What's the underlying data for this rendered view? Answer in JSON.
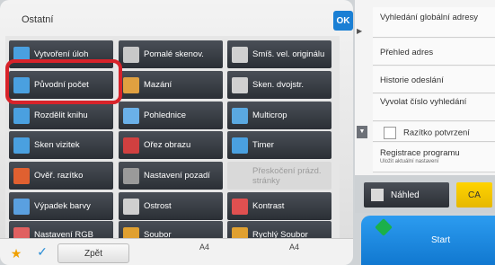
{
  "panel": {
    "title": "Ostatní",
    "ok_label": "OK"
  },
  "functions": [
    {
      "label": "Vytvoření úloh",
      "icon": "job-build-icon",
      "color": "#4aa0e0",
      "disabled": false
    },
    {
      "label": "Pomalé skenov.",
      "icon": "slow-scan-icon",
      "color": "#c8c8c8",
      "disabled": false
    },
    {
      "label": "Smíš. vel. originálu",
      "icon": "mixed-size-icon",
      "color": "#d0d0d0",
      "disabled": false
    },
    {
      "label": "Původní počet",
      "icon": "original-count-icon",
      "color": "#4aa0e0",
      "disabled": false
    },
    {
      "label": "Mazání",
      "icon": "erase-icon",
      "color": "#e0a040",
      "disabled": false
    },
    {
      "label": "Sken. dvojstr.",
      "icon": "dual-page-scan-icon",
      "color": "#d0d0d0",
      "disabled": false
    },
    {
      "label": "Rozdělit knihu",
      "icon": "book-divide-icon",
      "color": "#4aa0e0",
      "disabled": false
    },
    {
      "label": "Pohlednice",
      "icon": "postcard-icon",
      "color": "#6ab0e8",
      "disabled": false
    },
    {
      "label": "Multicrop",
      "icon": "multicrop-icon",
      "color": "#5aa8e0",
      "disabled": false
    },
    {
      "label": "Sken vizitek",
      "icon": "business-card-icon",
      "color": "#4aa0e0",
      "disabled": false
    },
    {
      "label": "Ořez obrazu",
      "icon": "image-crop-icon",
      "color": "#d04040",
      "disabled": false
    },
    {
      "label": "Timer",
      "icon": "timer-icon",
      "color": "#4aa0e0",
      "disabled": false
    },
    {
      "label": "Ověř. razítko",
      "icon": "verify-stamp-icon",
      "color": "#e06030",
      "disabled": false
    },
    {
      "label": "Nastavení pozadí",
      "icon": "background-setting-icon",
      "color": "#9a9a9a",
      "disabled": false
    },
    {
      "label": "Přeskočení prázd. stránky",
      "icon": "skip-blank-icon",
      "color": "#cccccc",
      "disabled": true
    },
    {
      "label": "Výpadek barvy",
      "icon": "color-dropout-icon",
      "color": "#5aa0e0",
      "disabled": false
    },
    {
      "label": "Ostrost",
      "icon": "sharpness-icon",
      "color": "#cfcfcf",
      "disabled": false
    },
    {
      "label": "Kontrast",
      "icon": "contrast-icon",
      "color": "#e05050",
      "disabled": false
    },
    {
      "label": "Nastavení RGB",
      "icon": "rgb-setting-icon",
      "color": "#e06060",
      "disabled": false
    },
    {
      "label": "Soubor",
      "icon": "folder-icon",
      "color": "#e0a030",
      "disabled": false
    },
    {
      "label": "Rychlý Soubor",
      "icon": "quick-file-icon",
      "color": "#e0a030",
      "disabled": false
    }
  ],
  "bottom": {
    "back_label": "Zpět",
    "paper_left": "A4",
    "paper_right": "A4"
  },
  "side_menu": [
    {
      "label": "Vyhledání globální adresy",
      "sub": ""
    },
    {
      "label": "Přehled adres",
      "sub": ""
    },
    {
      "label": "Historie odeslání",
      "sub": ""
    },
    {
      "label": "Vyvolat číslo vyhledání",
      "sub": ""
    },
    {
      "label": "Razítko potvrzení",
      "sub": ""
    },
    {
      "label": "Registrace programu",
      "sub": "Uložit aktuální nastavení"
    }
  ],
  "actions": {
    "preview_label": "Náhled",
    "ca_label": "CA",
    "start_label": "Start"
  }
}
